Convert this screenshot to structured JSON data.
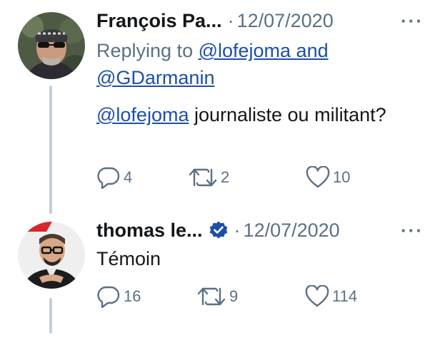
{
  "tweets": [
    {
      "author": "François Pa...",
      "separator": "·",
      "date": "12/07/2020",
      "more": "···",
      "replying_prefix": "Replying to ",
      "replying_mention_1": "@lofejoma and",
      "replying_mention_2": "@GDarmanin",
      "text_mention": "@lofejoma",
      "text_rest": " journaliste ou militant?",
      "replies": "4",
      "retweets": "2",
      "likes": "10"
    },
    {
      "author": "thomas le...",
      "verified": true,
      "separator": "·",
      "date": "12/07/2020",
      "more": "···",
      "text": "Témoin",
      "replies": "16",
      "retweets": "9",
      "likes": "114"
    }
  ],
  "colors": {
    "primary_text": "#14171a",
    "secondary_text": "#5b7083",
    "mention": "#1d4fa8",
    "verified_badge": "#1da1f2",
    "thread_line": "#c4cfd6"
  },
  "icons": {
    "reply": "reply-icon",
    "retweet": "retweet-icon",
    "like": "heart-icon",
    "more": "more-icon",
    "verified": "verified-badge-icon"
  }
}
